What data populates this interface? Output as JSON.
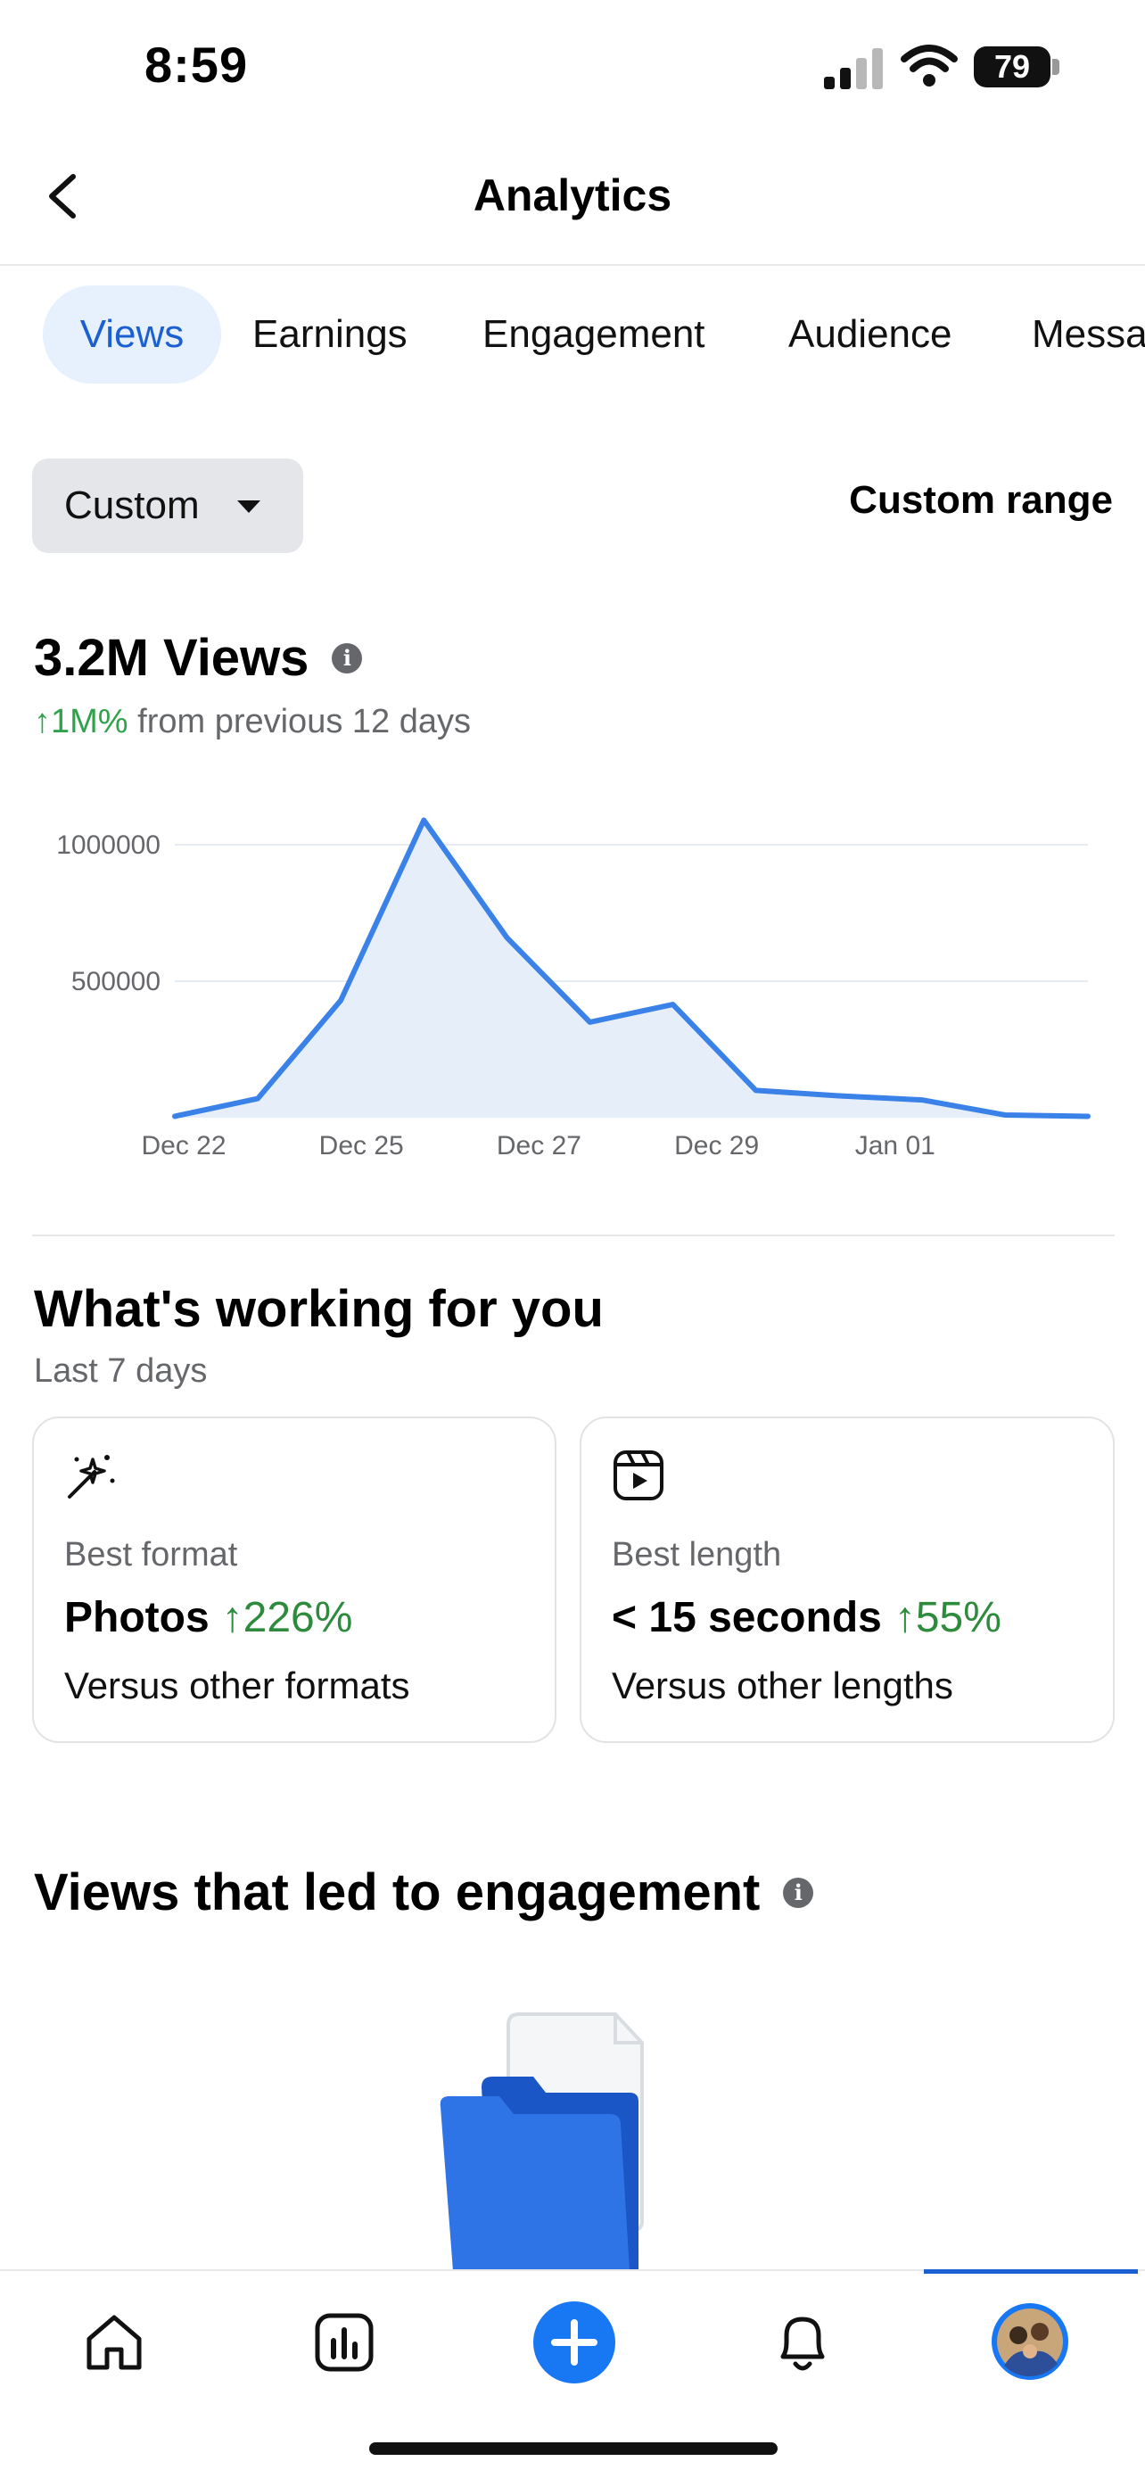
{
  "status_bar": {
    "time": "8:59",
    "battery": "79"
  },
  "header": {
    "title": "Analytics"
  },
  "tabs": [
    {
      "label": "Views",
      "active": true
    },
    {
      "label": "Earnings",
      "active": false
    },
    {
      "label": "Engagement",
      "active": false
    },
    {
      "label": "Audience",
      "active": false
    },
    {
      "label": "Messa",
      "active": false
    }
  ],
  "filters": {
    "period_label": "Custom",
    "range_label": "Custom range"
  },
  "summary": {
    "total": "3.2M Views",
    "change_value": "↑1M%",
    "change_text": " from previous 12 days"
  },
  "chart_data": {
    "type": "area",
    "title": "",
    "xlabel": "",
    "ylabel": "",
    "x_tick_labels": [
      "Dec 22",
      "Dec 25",
      "Dec 27",
      "Dec 29",
      "Jan 01"
    ],
    "y_tick_labels": [
      "1000000",
      "500000"
    ],
    "ylim": [
      0,
      1000000
    ],
    "grid": true,
    "x": [
      "Dec 22",
      "Dec 23",
      "Dec 24",
      "Dec 25",
      "Dec 26",
      "Dec 27",
      "Dec 28",
      "Dec 29",
      "Dec 30",
      "Dec 31",
      "Jan 01",
      "Jan 02"
    ],
    "values": [
      5000,
      70000,
      430000,
      1090000,
      660000,
      350000,
      415000,
      100000,
      80000,
      65000,
      10000,
      5000
    ],
    "colors": {
      "line": "#3b82e8",
      "fill": "#e6eff9",
      "grid": "#e6ecf2"
    }
  },
  "working": {
    "title": "What's working for you",
    "subtitle": "Last 7 days",
    "cards": [
      {
        "icon": "magic-wand-icon",
        "label": "Best format",
        "value": "Photos",
        "change": "↑226%",
        "versus": "Versus other formats"
      },
      {
        "icon": "reels-icon",
        "label": "Best length",
        "value": "< 15 seconds",
        "change": "↑55%",
        "versus": "Versus other lengths"
      }
    ]
  },
  "engagement": {
    "title": "Views that led to engagement"
  },
  "nav": {
    "items": [
      "home-icon",
      "insights-icon",
      "create-icon",
      "notifications-icon",
      "profile-avatar"
    ]
  },
  "colors": {
    "accent": "#1b5fd1",
    "positive": "#2e8b3e",
    "tab_active_bg": "#e7f0fd"
  }
}
